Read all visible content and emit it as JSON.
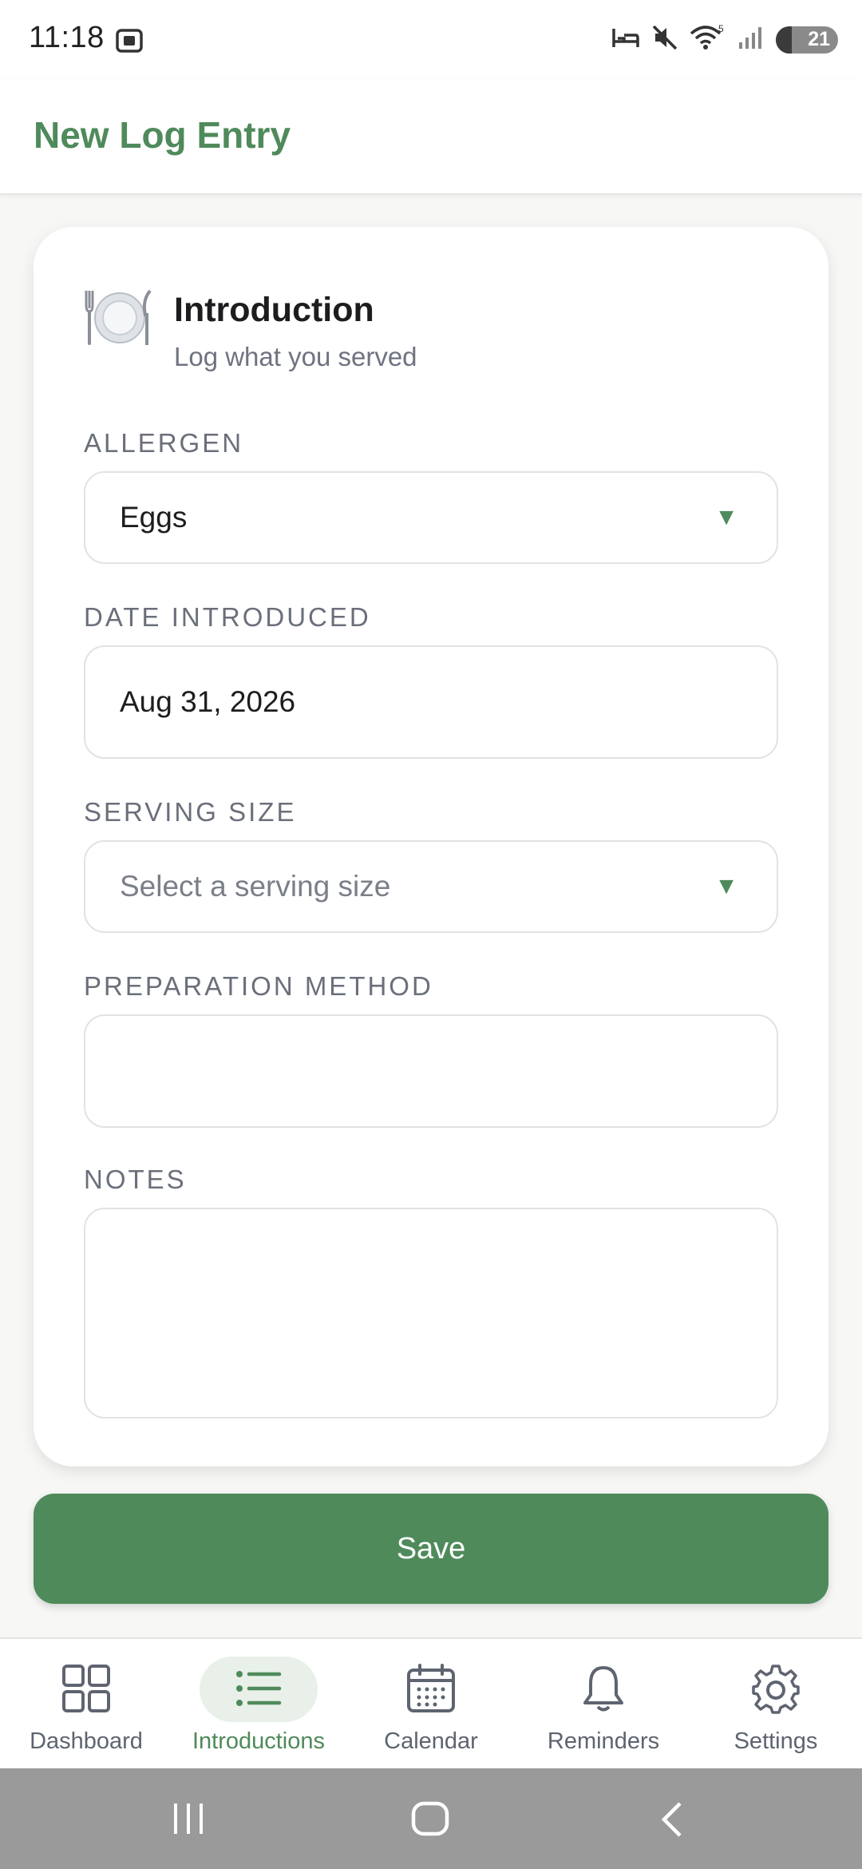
{
  "status_bar": {
    "time": "11:18",
    "battery": "21"
  },
  "app_bar": {
    "title": "New Log Entry"
  },
  "card": {
    "icon": "plate-icon",
    "title": "Introduction",
    "subtitle": "Log what you served"
  },
  "fields": {
    "allergen": {
      "label": "ALLERGEN",
      "value": "Eggs"
    },
    "date": {
      "label": "DATE INTRODUCED",
      "value": "Aug 31, 2026"
    },
    "serving": {
      "label": "SERVING SIZE",
      "placeholder": "Select a serving size"
    },
    "preparation": {
      "label": "PREPARATION METHOD",
      "value": ""
    },
    "notes": {
      "label": "NOTES",
      "value": ""
    }
  },
  "save_label": "Save",
  "nav": {
    "active": "Introductions",
    "items": [
      {
        "label": "Dashboard",
        "icon": "grid-icon"
      },
      {
        "label": "Introductions",
        "icon": "list-icon"
      },
      {
        "label": "Calendar",
        "icon": "calendar-icon"
      },
      {
        "label": "Reminders",
        "icon": "bell-icon"
      },
      {
        "label": "Settings",
        "icon": "gear-icon"
      }
    ]
  },
  "colors": {
    "accent": "#4f8a5b",
    "nav_active_bg": "#e8f0e9",
    "system_nav": "#9a9a9a"
  }
}
